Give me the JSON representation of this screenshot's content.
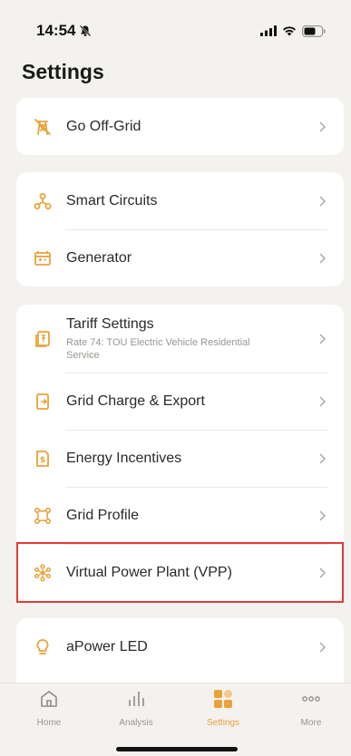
{
  "status": {
    "time": "14:54"
  },
  "page": {
    "title": "Settings"
  },
  "groups": [
    {
      "items": [
        {
          "label": "Go Off-Grid",
          "icon": "off-grid-icon"
        }
      ]
    },
    {
      "items": [
        {
          "label": "Smart Circuits",
          "icon": "smart-circuits-icon"
        },
        {
          "label": "Generator",
          "icon": "generator-icon"
        }
      ]
    },
    {
      "items": [
        {
          "label": "Tariff Settings",
          "sublabel": "Rate 74: TOU Electric Vehicle Residential Service",
          "icon": "tariff-icon"
        },
        {
          "label": "Grid Charge & Export",
          "icon": "grid-charge-icon"
        },
        {
          "label": "Energy Incentives",
          "icon": "energy-incentives-icon"
        },
        {
          "label": "Grid Profile",
          "icon": "grid-profile-icon"
        },
        {
          "label": "Virtual Power Plant (VPP)",
          "icon": "vpp-icon"
        }
      ]
    },
    {
      "items": [
        {
          "label": "aPower LED",
          "icon": "lightbulb-icon"
        }
      ]
    }
  ],
  "tabs": [
    {
      "label": "Home",
      "icon": "home-icon"
    },
    {
      "label": "Analysis",
      "icon": "analysis-icon"
    },
    {
      "label": "Settings",
      "icon": "settings-grid-icon",
      "active": true
    },
    {
      "label": "More",
      "icon": "more-icon"
    }
  ],
  "colors": {
    "accent": "#e9a23b",
    "background": "#f4f2ef",
    "highlight": "#e23b3b"
  }
}
